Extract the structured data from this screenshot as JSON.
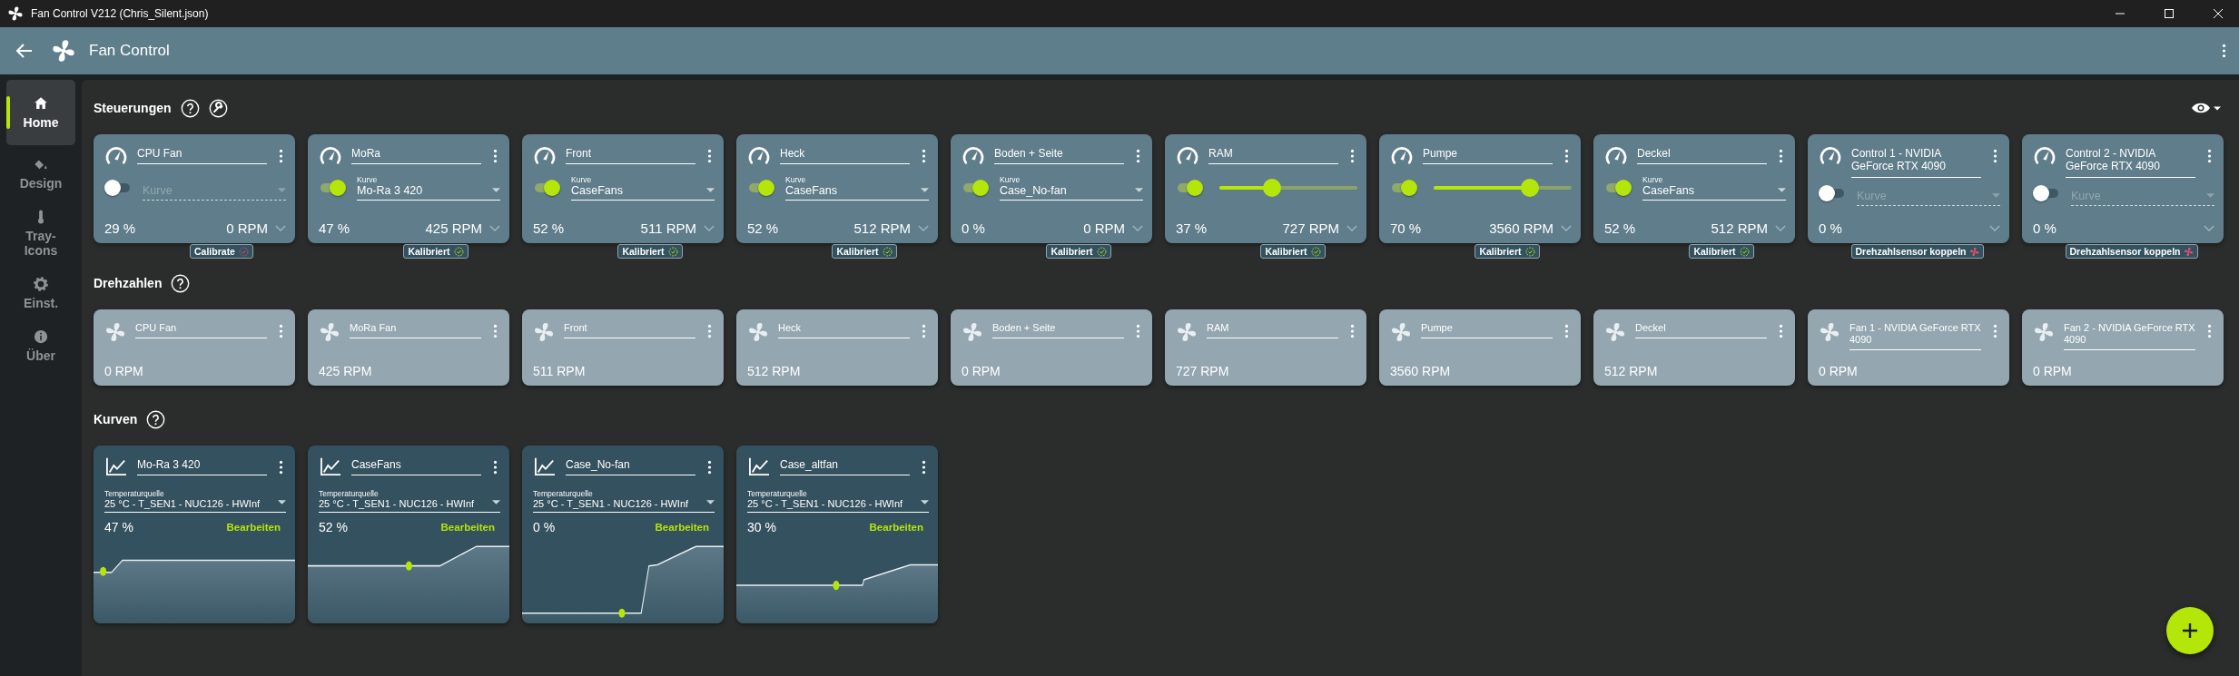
{
  "window": {
    "title": "Fan Control V212 (Chris_Silent.json)"
  },
  "app_bar": {
    "title": "Fan Control"
  },
  "sidebar": {
    "items": [
      {
        "label": "Home",
        "selected": true
      },
      {
        "label": "Design",
        "selected": false
      },
      {
        "label": "Tray-Icons",
        "selected": false
      },
      {
        "label": "Einst.",
        "selected": false
      },
      {
        "label": "Über",
        "selected": false
      }
    ]
  },
  "controls": {
    "title": "Steuerungen",
    "items": [
      {
        "kind": "curve",
        "name": "CPU Fan",
        "on": false,
        "curve_placeholder": "Kurve",
        "percent": "29 %",
        "rpm": "0 RPM",
        "badge": {
          "kind": "calibrate",
          "label": "Calibrate"
        }
      },
      {
        "kind": "curve",
        "name": "MoRa",
        "on": true,
        "curve_label": "Kurve",
        "curve": "Mo-Ra 3 420",
        "percent": "47 %",
        "rpm": "425 RPM",
        "badge": {
          "kind": "calibrated",
          "label": "Kalibriert"
        }
      },
      {
        "kind": "curve",
        "name": "Front",
        "on": true,
        "curve_label": "Kurve",
        "curve": "CaseFans",
        "percent": "52 %",
        "rpm": "511 RPM",
        "badge": {
          "kind": "calibrated",
          "label": "Kalibriert"
        }
      },
      {
        "kind": "curve",
        "name": "Heck",
        "on": true,
        "curve_label": "Kurve",
        "curve": "CaseFans",
        "percent": "52 %",
        "rpm": "512 RPM",
        "badge": {
          "kind": "calibrated",
          "label": "Kalibriert"
        }
      },
      {
        "kind": "curve",
        "name": "Boden + Seite",
        "on": true,
        "curve_label": "Kurve",
        "curve": "Case_No-fan",
        "percent": "0 %",
        "rpm": "0 RPM",
        "badge": {
          "kind": "calibrated",
          "label": "Kalibriert"
        }
      },
      {
        "kind": "slider",
        "name": "RAM",
        "on": true,
        "level": 0.38,
        "percent": "37 %",
        "rpm": "727 RPM",
        "badge": {
          "kind": "calibrated",
          "label": "Kalibriert"
        }
      },
      {
        "kind": "slider",
        "name": "Pumpe",
        "on": true,
        "level": 0.7,
        "percent": "70 %",
        "rpm": "3560 RPM",
        "badge": {
          "kind": "calibrated",
          "label": "Kalibriert"
        }
      },
      {
        "kind": "curve",
        "name": "Deckel",
        "on": true,
        "curve_label": "Kurve",
        "curve": "CaseFans",
        "percent": "52 %",
        "rpm": "512 RPM",
        "badge": {
          "kind": "calibrated",
          "label": "Kalibriert"
        }
      },
      {
        "kind": "curve",
        "name": "Control 1 - NVIDIA GeForce RTX 4090",
        "on": false,
        "curve_placeholder": "Kurve",
        "percent": "0 %",
        "badge": {
          "kind": "pair",
          "label": "Drehzahlsensor koppeln"
        }
      },
      {
        "kind": "curve",
        "name": "Control 2 - NVIDIA GeForce RTX 4090",
        "on": false,
        "curve_placeholder": "Kurve",
        "percent": "0 %",
        "badge": {
          "kind": "pair",
          "label": "Drehzahlsensor koppeln"
        }
      }
    ]
  },
  "speeds": {
    "title": "Drehzahlen",
    "items": [
      {
        "name": "CPU Fan",
        "rpm": "0 RPM"
      },
      {
        "name": "MoRa Fan",
        "rpm": "425 RPM"
      },
      {
        "name": "Front",
        "rpm": "511 RPM"
      },
      {
        "name": "Heck",
        "rpm": "512 RPM"
      },
      {
        "name": "Boden + Seite",
        "rpm": "0 RPM"
      },
      {
        "name": "RAM",
        "rpm": "727 RPM"
      },
      {
        "name": "Pumpe",
        "rpm": "3560 RPM"
      },
      {
        "name": "Deckel",
        "rpm": "512 RPM"
      },
      {
        "name": "Fan 1 - NVIDIA GeForce RTX 4090",
        "rpm": "0 RPM"
      },
      {
        "name": "Fan 2 - NVIDIA GeForce RTX 4090",
        "rpm": "0 RPM"
      }
    ]
  },
  "curves": {
    "title": "Kurven",
    "items": [
      {
        "name": "Mo-Ra 3 420",
        "source_label": "Temperaturquelle",
        "source": "25 °C - T_SEN1 - NUC126 - HWInf",
        "percent": "47 %",
        "action": "Bearbeiten"
      },
      {
        "name": "CaseFans",
        "source_label": "Temperaturquelle",
        "source": "25 °C - T_SEN1 - NUC126 - HWInf",
        "percent": "52 %",
        "action": "Bearbeiten"
      },
      {
        "name": "Case_No-fan",
        "source_label": "Temperaturquelle",
        "source": "25 °C - T_SEN1 - NUC126 - HWInf",
        "percent": "0 %",
        "action": "Bearbeiten"
      },
      {
        "name": "Case_altfan",
        "source_label": "Temperaturquelle",
        "source": "25 °C - T_SEN1 - NUC126 - HWInf",
        "percent": "30 %",
        "action": "Bearbeiten"
      }
    ]
  }
}
